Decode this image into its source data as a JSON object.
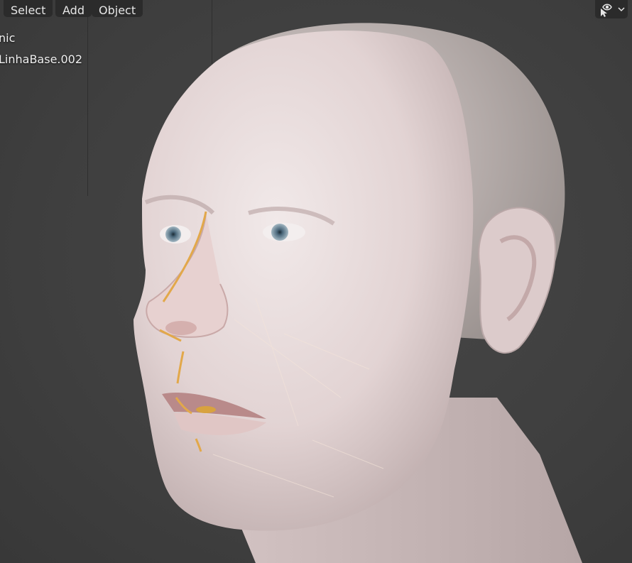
{
  "header": {
    "menus": [
      {
        "label": "Select"
      },
      {
        "label": "Add"
      },
      {
        "label": "Object"
      }
    ]
  },
  "overlay": {
    "line1": "nic",
    "line2": "LinhaBase.002"
  },
  "toolbar": {
    "visibility_icon": "eye-selectability-icon",
    "dropdown_icon": "chevron-down-icon"
  },
  "colors": {
    "viewport_bg": "#3d3d3d",
    "header_button": "#2b2b2b",
    "skin": "#e6dcdc"
  }
}
